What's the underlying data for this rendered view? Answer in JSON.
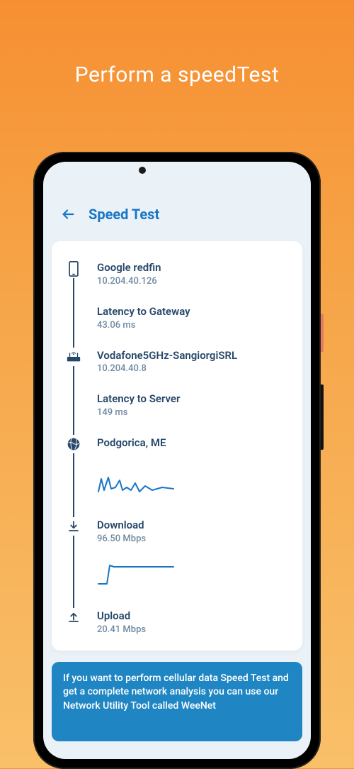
{
  "headline": "Perform a speedTest",
  "header": {
    "title": "Speed Test"
  },
  "device": {
    "name": "Google redfin",
    "ip": "10.204.40.126"
  },
  "latency_gateway": {
    "label": "Latency to Gateway",
    "value": "43.06 ms"
  },
  "router": {
    "ssid": "Vodafone5GHz-SangiorgiSRL",
    "ip": "10.204.40.8"
  },
  "latency_server": {
    "label": "Latency to Server",
    "value": "149 ms"
  },
  "server": {
    "location": "Podgorica, ME"
  },
  "download": {
    "label": "Download",
    "value": "96.50 Mbps"
  },
  "upload": {
    "label": "Upload",
    "value": "20.41 Mbps"
  },
  "tip": "If you want to perform cellular data Speed Test and get a complete network analysis you can use our Network Utility Tool called WeeNet"
}
